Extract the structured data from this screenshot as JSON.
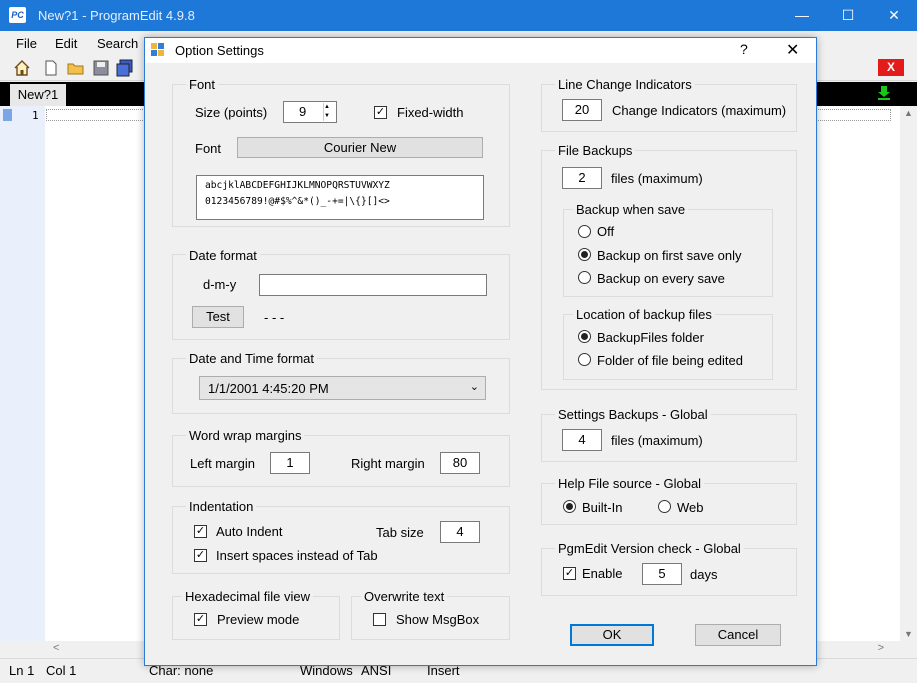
{
  "app": {
    "logo": "PC",
    "title": "New?1  -  ProgramEdit 4.9.8",
    "window_controls": {
      "minimize": "—",
      "maximize": "☐",
      "close": "✕"
    }
  },
  "menu": [
    "File",
    "Edit",
    "Search"
  ],
  "toolbar": {
    "icons": [
      "home-icon",
      "new-file-icon",
      "open-folder-icon",
      "save-icon",
      "save-all-icon"
    ],
    "close_doc": "X"
  },
  "tabs": [
    {
      "label": "New?1",
      "active": true
    }
  ],
  "editor": {
    "line_number": "1"
  },
  "statusbar": {
    "line": "Ln 1",
    "col": "Col 1",
    "char": "Char: none",
    "eol": "Windows",
    "encoding": "ANSI",
    "mode": "Insert"
  },
  "dialog": {
    "title": "Option Settings",
    "help": "?",
    "close": "✕",
    "font": {
      "group": "Font",
      "size_label": "Size (points)",
      "size_value": "9",
      "fixed_width_label": "Fixed-width",
      "fixed_width_checked": true,
      "font_label": "Font",
      "font_button": "Courier New",
      "preview_line1": "abcjklABCDEFGHIJKLMNOPQRSTUVWXYZ",
      "preview_line2": "0123456789!@#$%^&*()_-+=|\\{}[]<>"
    },
    "date_format": {
      "group": "Date format",
      "pattern": "d-m-y",
      "value": "",
      "test_button": "Test",
      "result": "- - -"
    },
    "datetime_format": {
      "group": "Date and Time format",
      "selected": "1/1/2001 4:45:20 PM"
    },
    "word_wrap": {
      "group": "Word wrap margins",
      "left_label": "Left margin",
      "left_value": "1",
      "right_label": "Right margin",
      "right_value": "80"
    },
    "indentation": {
      "group": "Indentation",
      "auto_indent": "Auto Indent",
      "auto_indent_checked": true,
      "tab_size_label": "Tab size",
      "tab_size_value": "4",
      "insert_spaces": "Insert spaces instead of Tab",
      "insert_spaces_checked": true
    },
    "hex_view": {
      "group": "Hexadecimal file view",
      "preview": "Preview mode",
      "preview_checked": true
    },
    "overwrite": {
      "group": "Overwrite text",
      "msgbox": "Show MsgBox",
      "msgbox_checked": false
    },
    "line_change": {
      "group": "Line Change Indicators",
      "value": "20",
      "label": "Change Indicators (maximum)"
    },
    "file_backups": {
      "group": "File Backups",
      "value": "2",
      "label": "files (maximum)",
      "when_group": "Backup when save",
      "when_options": [
        "Off",
        "Backup on first save only",
        "Backup on every save"
      ],
      "when_selected": "Backup on first save only",
      "location_group": "Location of backup files",
      "location_options": [
        "BackupFiles folder",
        "Folder of file being edited"
      ],
      "location_selected": "BackupFiles folder"
    },
    "settings_backups": {
      "group": "Settings Backups - Global",
      "value": "4",
      "label": "files (maximum)"
    },
    "help_source": {
      "group": "Help File source - Global",
      "options": [
        "Built-In",
        "Web"
      ],
      "selected": "Built-In"
    },
    "version_check": {
      "group": "PgmEdit Version check - Global",
      "enable": "Enable",
      "enable_checked": true,
      "days_value": "5",
      "days_label": "days"
    },
    "ok": "OK",
    "cancel": "Cancel"
  },
  "colors": {
    "titlebar": "#1e78d7",
    "dialog_border": "#2b7bd6",
    "close_doc": "#e31b1b"
  }
}
